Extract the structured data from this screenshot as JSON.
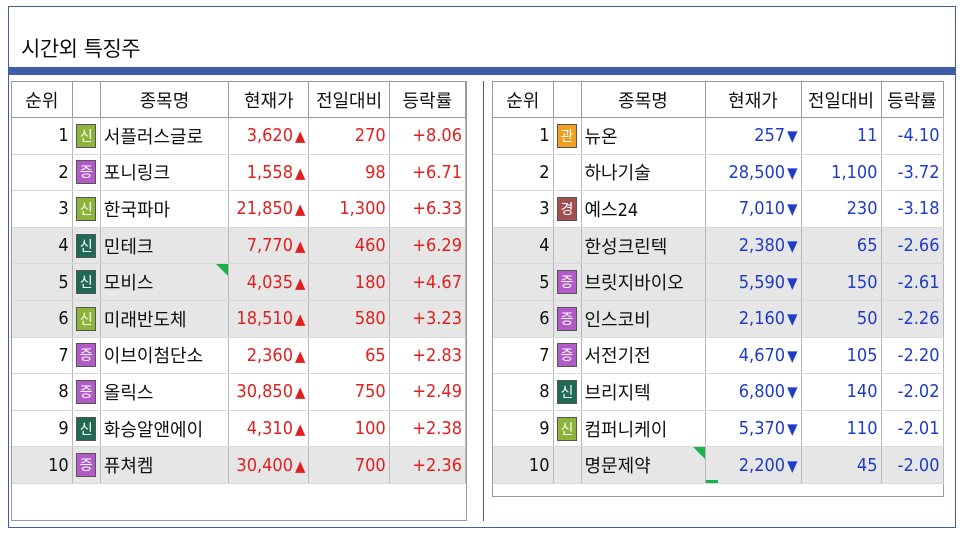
{
  "title": "시간외 특징주",
  "colors": {
    "up": "#e0201e",
    "down": "#1e3cc8",
    "badge_sin_light": "#8cb43a",
    "badge_sin_dark": "#1e6a55",
    "badge_jeung": "#b25ac8",
    "badge_gwan": "#f0a020",
    "badge_gyeong": "#a05050",
    "accent_bar": "#3d5fa8"
  },
  "left": {
    "headers": [
      "순위",
      "",
      "종목명",
      "현재가",
      "전일대비",
      "등락률"
    ],
    "rows": [
      {
        "rank": "1",
        "badge": "신",
        "badge_color": "#8cb43a",
        "name": "서플러스글로",
        "price": "3,620",
        "dir": "▲",
        "change": "270",
        "rate": "+8.06",
        "shade": false,
        "flag": false
      },
      {
        "rank": "2",
        "badge": "증",
        "badge_color": "#b25ac8",
        "name": "포니링크",
        "price": "1,558",
        "dir": "▲",
        "change": "98",
        "rate": "+6.71",
        "shade": false,
        "flag": false
      },
      {
        "rank": "3",
        "badge": "신",
        "badge_color": "#8cb43a",
        "name": "한국파마",
        "price": "21,850",
        "dir": "▲",
        "change": "1,300",
        "rate": "+6.33",
        "shade": false,
        "flag": false
      },
      {
        "rank": "4",
        "badge": "신",
        "badge_color": "#1e6a55",
        "name": "민테크",
        "price": "7,770",
        "dir": "▲",
        "change": "460",
        "rate": "+6.29",
        "shade": true,
        "flag": false
      },
      {
        "rank": "5",
        "badge": "신",
        "badge_color": "#1e6a55",
        "name": "모비스",
        "price": "4,035",
        "dir": "▲",
        "change": "180",
        "rate": "+4.67",
        "shade": true,
        "flag": true
      },
      {
        "rank": "6",
        "badge": "신",
        "badge_color": "#8cb43a",
        "name": "미래반도체",
        "price": "18,510",
        "dir": "▲",
        "change": "580",
        "rate": "+3.23",
        "shade": true,
        "flag": false
      },
      {
        "rank": "7",
        "badge": "증",
        "badge_color": "#b25ac8",
        "name": "이브이첨단소",
        "price": "2,360",
        "dir": "▲",
        "change": "65",
        "rate": "+2.83",
        "shade": false,
        "flag": false
      },
      {
        "rank": "8",
        "badge": "증",
        "badge_color": "#b25ac8",
        "name": "올릭스",
        "price": "30,850",
        "dir": "▲",
        "change": "750",
        "rate": "+2.49",
        "shade": false,
        "flag": false
      },
      {
        "rank": "9",
        "badge": "신",
        "badge_color": "#1e6a55",
        "name": "화승알앤에이",
        "price": "4,310",
        "dir": "▲",
        "change": "100",
        "rate": "+2.38",
        "shade": false,
        "flag": false
      },
      {
        "rank": "10",
        "badge": "증",
        "badge_color": "#b25ac8",
        "name": "퓨쳐켐",
        "price": "30,400",
        "dir": "▲",
        "change": "700",
        "rate": "+2.36",
        "shade": true,
        "flag": false
      }
    ]
  },
  "right": {
    "headers": [
      "순위",
      "",
      "종목명",
      "현재가",
      "전일대비",
      "등락률"
    ],
    "rows": [
      {
        "rank": "1",
        "badge": "관",
        "badge_color": "#f0a020",
        "name": "뉴온",
        "price": "257",
        "dir": "▼",
        "change": "11",
        "rate": "-4.10",
        "shade": false,
        "flag": false
      },
      {
        "rank": "2",
        "badge": "",
        "badge_color": "",
        "name": "하나기술",
        "price": "28,500",
        "dir": "▼",
        "change": "1,100",
        "rate": "-3.72",
        "shade": false,
        "flag": false
      },
      {
        "rank": "3",
        "badge": "경",
        "badge_color": "#a05050",
        "name": "예스24",
        "price": "7,010",
        "dir": "▼",
        "change": "230",
        "rate": "-3.18",
        "shade": false,
        "flag": false
      },
      {
        "rank": "4",
        "badge": "",
        "badge_color": "",
        "name": "한성크린텍",
        "price": "2,380",
        "dir": "▼",
        "change": "65",
        "rate": "-2.66",
        "shade": true,
        "flag": false
      },
      {
        "rank": "5",
        "badge": "증",
        "badge_color": "#b25ac8",
        "name": "브릿지바이오",
        "price": "5,590",
        "dir": "▼",
        "change": "150",
        "rate": "-2.61",
        "shade": true,
        "flag": false
      },
      {
        "rank": "6",
        "badge": "증",
        "badge_color": "#b25ac8",
        "name": "인스코비",
        "price": "2,160",
        "dir": "▼",
        "change": "50",
        "rate": "-2.26",
        "shade": true,
        "flag": false
      },
      {
        "rank": "7",
        "badge": "증",
        "badge_color": "#b25ac8",
        "name": "서전기전",
        "price": "4,670",
        "dir": "▼",
        "change": "105",
        "rate": "-2.20",
        "shade": false,
        "flag": false
      },
      {
        "rank": "8",
        "badge": "신",
        "badge_color": "#1e6a55",
        "name": "브리지텍",
        "price": "6,800",
        "dir": "▼",
        "change": "140",
        "rate": "-2.02",
        "shade": false,
        "flag": false
      },
      {
        "rank": "9",
        "badge": "신",
        "badge_color": "#8cb43a",
        "name": "컴퍼니케이",
        "price": "5,370",
        "dir": "▼",
        "change": "110",
        "rate": "-2.01",
        "shade": false,
        "flag": false
      },
      {
        "rank": "10",
        "badge": "",
        "badge_color": "",
        "name": "명문제약",
        "price": "2,200",
        "dir": "▼",
        "change": "45",
        "rate": "-2.00",
        "shade": true,
        "flag": true
      }
    ]
  }
}
